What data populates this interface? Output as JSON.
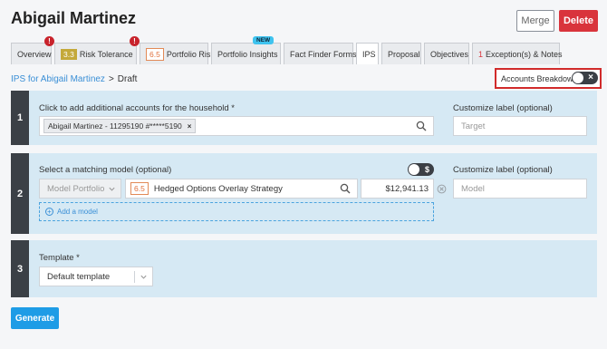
{
  "page": {
    "title": "Abigail Martinez"
  },
  "header": {
    "merge_label": "Merge",
    "delete_label": "Delete"
  },
  "tabs": [
    {
      "label": "Overview",
      "alert": "!"
    },
    {
      "label": "Risk Tolerance",
      "score": "3.3",
      "alert": "!"
    },
    {
      "label": "Portfolio Risk",
      "score": "6.5"
    },
    {
      "label": "Portfolio Insights",
      "badge": "NEW"
    },
    {
      "label": "Fact Finder Forms"
    },
    {
      "label": "IPS"
    },
    {
      "label": "Proposal"
    },
    {
      "label": "Objectives"
    },
    {
      "label": "Exception(s) & Notes",
      "count": "1"
    }
  ],
  "breadcrumb": {
    "link": "IPS for Abigail Martinez",
    "separator": ">",
    "current": "Draft"
  },
  "accounts_breakdown": {
    "label": "Accounts Breakdown",
    "enabled": false
  },
  "step1": {
    "number": "1",
    "label": "Click to add additional accounts for the household *",
    "account_chip": "Abigail Martinez - 11295190 #*****5190",
    "custom_label": "Customize label (optional)",
    "target_placeholder": "Target"
  },
  "step2": {
    "number": "2",
    "label": "Select a matching model (optional)",
    "model_type": "Model Portfolio",
    "model_score": "6.5",
    "model_name": "Hedged Options Overlay Strategy",
    "amount": "$12,941.13",
    "add_model": "Add a model",
    "custom_label": "Customize label (optional)",
    "model_placeholder": "Model",
    "dollar_toggle_enabled": true
  },
  "step3": {
    "number": "3",
    "label": "Template *",
    "selected_template": "Default template"
  },
  "footer": {
    "generate_label": "Generate"
  },
  "colors": {
    "accent": "#1e9ce6",
    "danger": "#d9343c",
    "step_bg": "#d6e9f4",
    "step_number_bg": "#3b4046",
    "highlight_border": "#d12b2b"
  }
}
